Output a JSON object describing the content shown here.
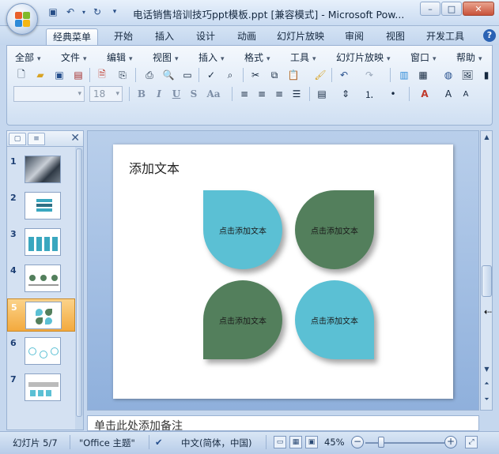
{
  "window": {
    "title": "电话销售培训技巧ppt模板.ppt [兼容模式] - Microsoft Pow...",
    "controls": {
      "minimize": "–",
      "maximize": "□",
      "close": "✕"
    }
  },
  "quick_access": [
    {
      "name": "save-icon",
      "glyph": "💾"
    },
    {
      "name": "undo-icon",
      "glyph": "↶"
    },
    {
      "name": "redo-icon",
      "glyph": "↻"
    },
    {
      "name": "customize-qat-icon",
      "glyph": "▾"
    }
  ],
  "ribbon_tabs": [
    "经典菜单",
    "开始",
    "插入",
    "设计",
    "动画",
    "幻灯片放映",
    "审阅",
    "视图",
    "开发工具"
  ],
  "active_tab": "经典菜单",
  "menus": [
    "全部",
    "文件",
    "编辑",
    "视图",
    "插入",
    "格式",
    "工具",
    "幻灯片放映",
    "窗口",
    "帮助"
  ],
  "font_combo": {
    "font_name": "",
    "font_size": "18"
  },
  "format_buttons": [
    "B",
    "I",
    "U",
    "S",
    "Aa"
  ],
  "thumbnails": [
    {
      "number": "1"
    },
    {
      "number": "2"
    },
    {
      "number": "3"
    },
    {
      "number": "4"
    },
    {
      "number": "5"
    },
    {
      "number": "6"
    },
    {
      "number": "7"
    }
  ],
  "selected_slide": "5",
  "slide": {
    "title": "添加文本",
    "petals": [
      {
        "text": "点击添加文本",
        "color": "#5bc0d4"
      },
      {
        "text": "点击添加文本",
        "color": "#537f5c"
      },
      {
        "text": "点击添加文本",
        "color": "#537f5c"
      },
      {
        "text": "点击添加文本",
        "color": "#5bc0d4"
      }
    ]
  },
  "notes_placeholder": "单击此处添加备注",
  "status": {
    "slide_counter": "幻灯片 5/7",
    "theme": "\"Office 主题\"",
    "language": "中文(简体，中国)",
    "zoom": "45%"
  },
  "colors": {
    "accent_blue": "#5bc0d4",
    "accent_green": "#537f5c",
    "selection_orange": "#f3a93d"
  }
}
